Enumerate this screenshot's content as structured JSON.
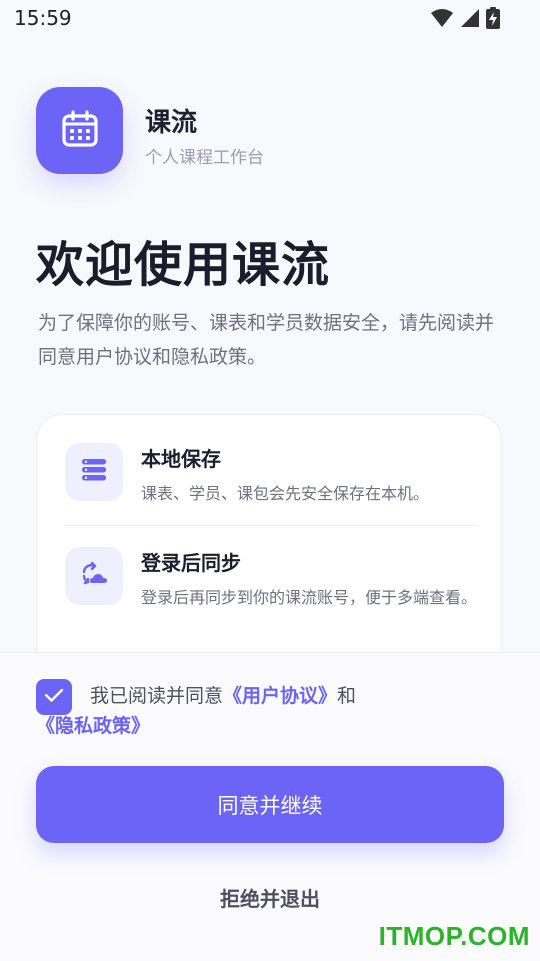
{
  "status_bar": {
    "time": "15:59",
    "icons": [
      "wifi-icon",
      "cellular-signal-icon",
      "battery-charging-icon"
    ]
  },
  "app": {
    "name": "课流",
    "tagline": "个人课程工作台",
    "icon": "calendar-icon"
  },
  "welcome": {
    "title": "欢迎使用课流",
    "intro": "为了保障你的账号、课表和学员数据安全，请先阅读并同意用户协议和隐私政策。"
  },
  "features": [
    {
      "icon": "storage-stack-icon",
      "title": "本地保存",
      "desc": "课表、学员、课包会先安全保存在本机。"
    },
    {
      "icon": "cloud-sync-icon",
      "title": "登录后同步",
      "desc": "登录后再同步到你的课流账号，便于多端查看。"
    }
  ],
  "agreement": {
    "checked": true,
    "prefix": "我已阅读并同意",
    "user_agreement": "《用户协议》",
    "connector": "和",
    "privacy_policy": "《隐私政策》"
  },
  "actions": {
    "agree_continue": "同意并继续",
    "reject_exit": "拒绝并退出"
  },
  "watermark": "ITMOP.COM",
  "colors": {
    "accent": "#6c63f7",
    "background": "#f8f9fd",
    "icon_tint_bg": "#efefff",
    "watermark": "#2bb42b"
  }
}
